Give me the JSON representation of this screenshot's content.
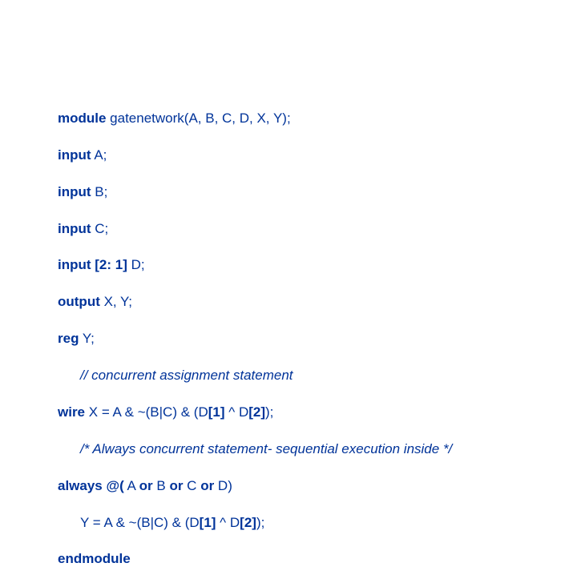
{
  "code": {
    "l1_kw": "module",
    "l1_rest": " gatenetwork(A, B, C, D, X, Y);",
    "l2_kw": "input",
    "l2_rest": " A;",
    "l3_kw": "input",
    "l3_rest": " B;",
    "l4_kw": "input",
    "l4_rest": " C;",
    "l5_kw": "input [2: 1]",
    "l5_rest": " D;",
    "l6_kw": "output",
    "l6_rest": " X, Y;",
    "l7_kw": "reg",
    "l7_rest": " Y;",
    "l8_comment": "// concurrent assignment statement",
    "l9_kw1": "wire",
    "l9_p1": " X = A & ~(B|C) & (D",
    "l9_idx1": "[1]",
    "l9_p2": " ^ D",
    "l9_idx2": "[2]",
    "l9_p3": ");",
    "l10_comment": "/* Always concurrent statement- sequential execution inside */",
    "l11_kw1": "always @(",
    "l11_p1": " A ",
    "l11_kw2": "or",
    "l11_p2": " B ",
    "l11_kw3": "or",
    "l11_p3": " C ",
    "l11_kw4": "or",
    "l11_p4": " D)",
    "l12_p1": "Y = A & ~(B|C) & (D",
    "l12_idx1": "[1]",
    "l12_p2": " ^ D",
    "l12_idx2": "[2]",
    "l12_p3": ");",
    "l13_kw": "endmodule"
  }
}
